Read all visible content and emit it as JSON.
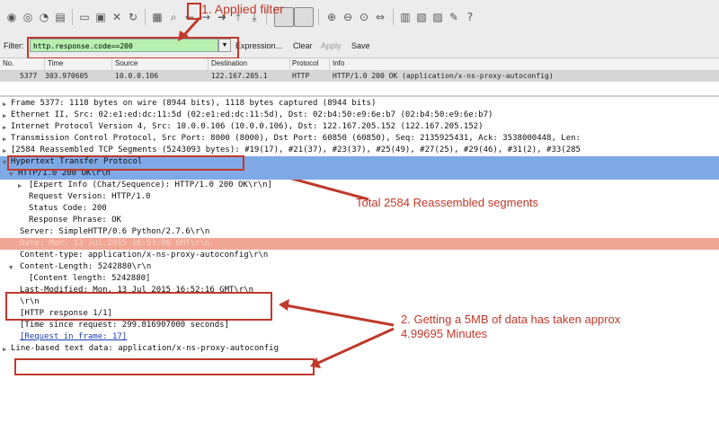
{
  "toolbar": {
    "icons": [
      "record-icon",
      "stop-icon",
      "restart-icon",
      "options-icon",
      "open-icon",
      "save-icon",
      "close-icon",
      "reload-icon",
      "print-icon",
      "find-icon",
      "back-icon",
      "forward-icon",
      "goto-icon",
      "first-icon",
      "last-icon",
      "colorize-icon",
      "autoscroll-icon",
      "zoom-in-icon",
      "zoom-out-icon",
      "zoom-normal-icon",
      "resize-columns-icon",
      "capture-filters-icon",
      "display-filters-icon",
      "coloring-rules-icon",
      "preferences-icon",
      "help-icon"
    ]
  },
  "filter": {
    "label": "Filter:",
    "value": "http.response.code==200",
    "expression": "Expression...",
    "clear": "Clear",
    "apply": "Apply",
    "save": "Save"
  },
  "packet_list": {
    "columns": [
      "No.",
      "Time",
      "Source",
      "Destination",
      "Protocol",
      "Info"
    ],
    "row": {
      "no": "5377",
      "time": "303.970605",
      "source": "10.0.0.106",
      "destination": "122.167.205.1",
      "protocol": "HTTP",
      "info": "HTTP/1.0 200 OK  (application/x-ns-proxy-autoconfig)"
    }
  },
  "details": {
    "frame": "Frame 5377: 1118 bytes on wire (8944 bits), 1118 bytes captured (8944 bits)",
    "ethernet": "Ethernet II, Src: 02:e1:ed:dc:11:5d (02:e1:ed:dc:11:5d), Dst: 02:b4:50:e9:6e:b7 (02:b4:50:e9:6e:b7)",
    "ip": "Internet Protocol Version 4, Src: 10.0.0.106 (10.0.0.106), Dst: 122.167.205.152 (122.167.205.152)",
    "tcp": "Transmission Control Protocol, Src Port: 8000 (8000), Dst Port: 60850 (60850), Seq: 2135925431, Ack: 3538000448, Len:",
    "reassembled": "[2584 Reassembled TCP Segments (5243093 bytes): #19(17), #21(37), #23(37), #25(49), #27(25), #29(46), #31(2), #33(285",
    "http": "Hypertext Transfer Protocol",
    "status_line": "HTTP/1.0 200 OK\\r\\n",
    "expert": "[Expert Info (Chat/Sequence): HTTP/1.0 200 OK\\r\\n]",
    "request_version": "Request Version: HTTP/1.0",
    "status_code": "Status Code: 200",
    "response_phrase": "Response Phrase: OK",
    "server": "Server: SimpleHTTP/0.6 Python/2.7.6\\r\\n",
    "date": "Date: Mon, 13 Jul 2015 16:53:06 GMT\\r\\n",
    "content_type": "Content-type: application/x-ns-proxy-autoconfig\\r\\n",
    "content_length": "Content-Length: 5242880\\r\\n",
    "content_length_inner": "[Content length: 5242880]",
    "last_modified": "Last-Modified: Mon, 13 Jul 2015 16:52:16 GMT\\r\\n",
    "crlf": "\\r\\n",
    "http_response": "[HTTP response 1/1]",
    "time_since": "[Time since request: 299.816907000 seconds]",
    "request_in_frame": "[Request in frame: 17]",
    "line_based": "Line-based text data: application/x-ns-proxy-autoconfig"
  },
  "annotations": {
    "applied_filter": "1. Applied filter",
    "total_segments": "Total 2584 Reassembled segments",
    "getting_5mb_line1": "2. Getting a 5MB of data has taken approx",
    "getting_5mb_line2": "4.99695 Minutes"
  },
  "colors": {
    "filter_ok": "#b7f0b0",
    "selection": "#7fa9e6",
    "date_highlight": "#f1a795",
    "annotation": "#c0392b"
  }
}
